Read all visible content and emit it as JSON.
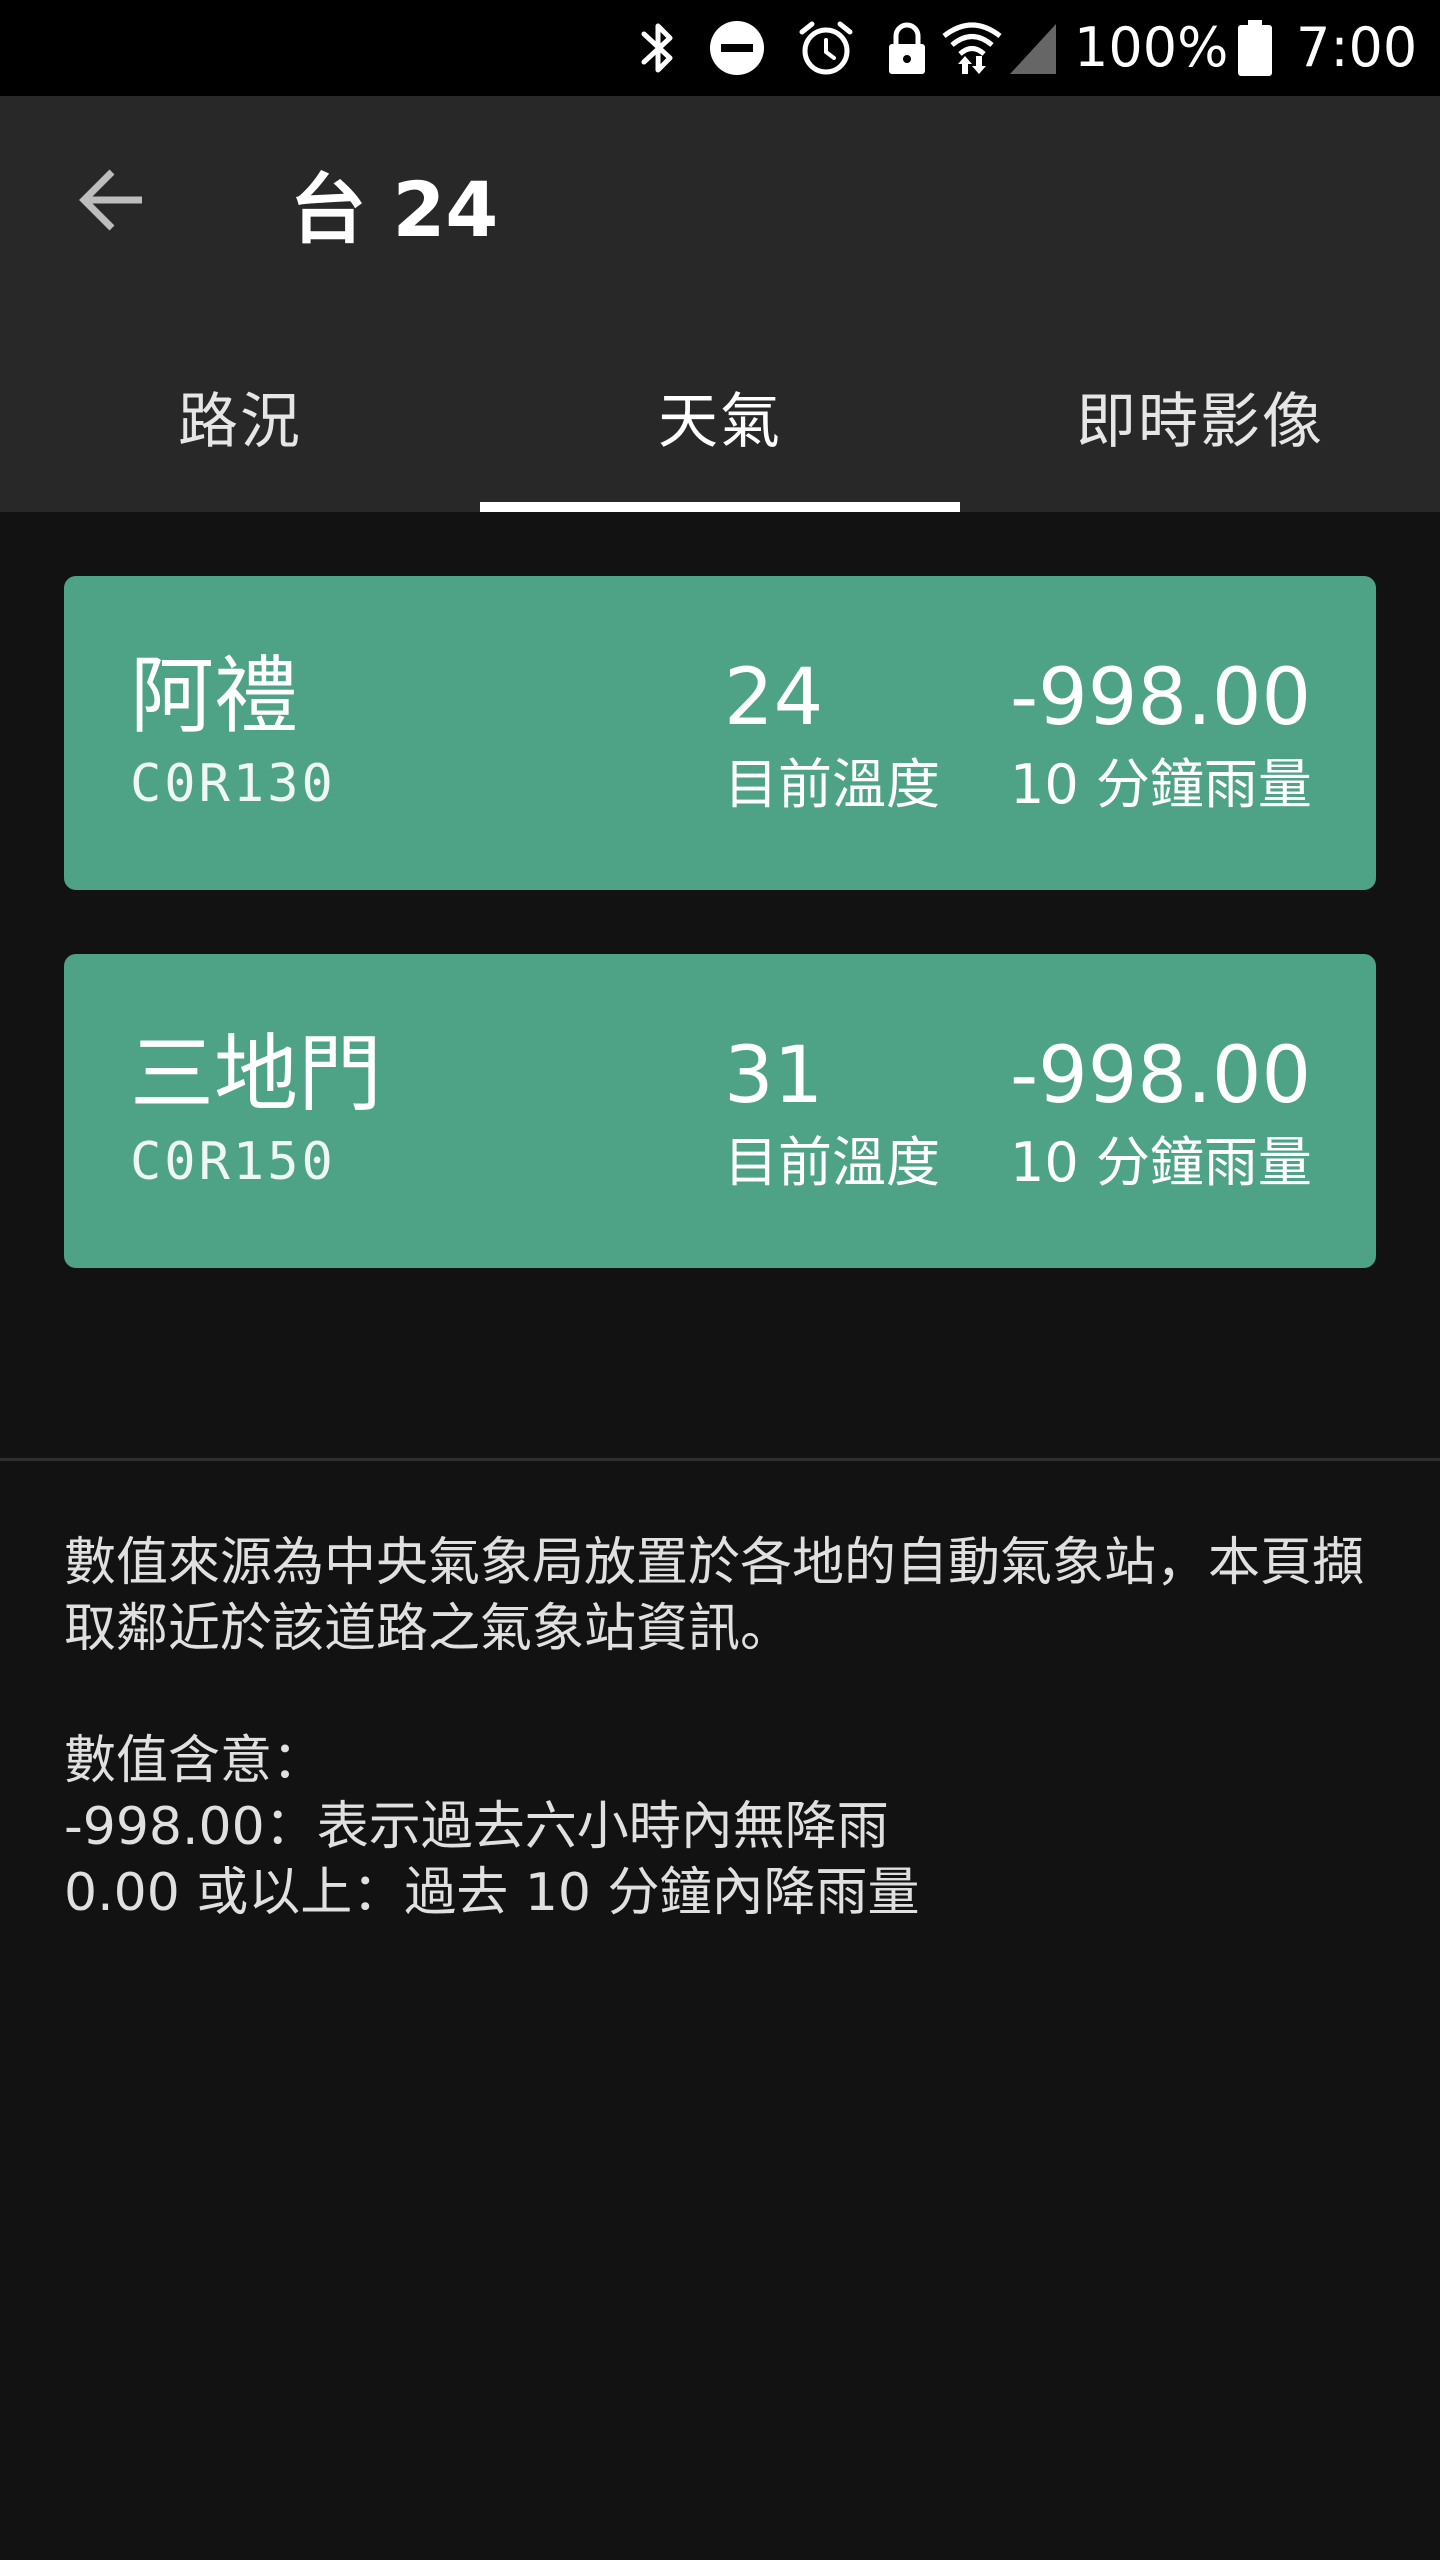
{
  "status_bar": {
    "battery": "100%",
    "time": "7:00",
    "icons": [
      "bluetooth-icon",
      "do-not-disturb-icon",
      "alarm-icon",
      "lock-icon",
      "wifi-icon",
      "signal-icon",
      "battery-icon"
    ]
  },
  "appbar": {
    "back_icon": "arrow-left-icon",
    "title": "台 24"
  },
  "tabs": [
    {
      "label": "路況",
      "active": false
    },
    {
      "label": "天氣",
      "active": true
    },
    {
      "label": "即時影像",
      "active": false
    }
  ],
  "stations": [
    {
      "name": "阿禮",
      "code": "C0R130",
      "temperature": "24",
      "temperature_label": "目前溫度",
      "rainfall": "-998.00",
      "rainfall_label": "10 分鐘雨量"
    },
    {
      "name": "三地門",
      "code": "C0R150",
      "temperature": "31",
      "temperature_label": "目前溫度",
      "rainfall": "-998.00",
      "rainfall_label": "10 分鐘雨量"
    }
  ],
  "colors": {
    "card": "#4ea386",
    "appbar": "#282828",
    "background": "#121212"
  },
  "note": {
    "source": "數值來源為中央氣象局放置於各地的自動氣象站，本頁擷取鄰近於該道路之氣象站資訊。",
    "meaning_title": "數值含意：",
    "meaning_line1": "-998.00：表示過去六小時內無降雨",
    "meaning_line2": "0.00 或以上：過去 10 分鐘內降雨量"
  }
}
